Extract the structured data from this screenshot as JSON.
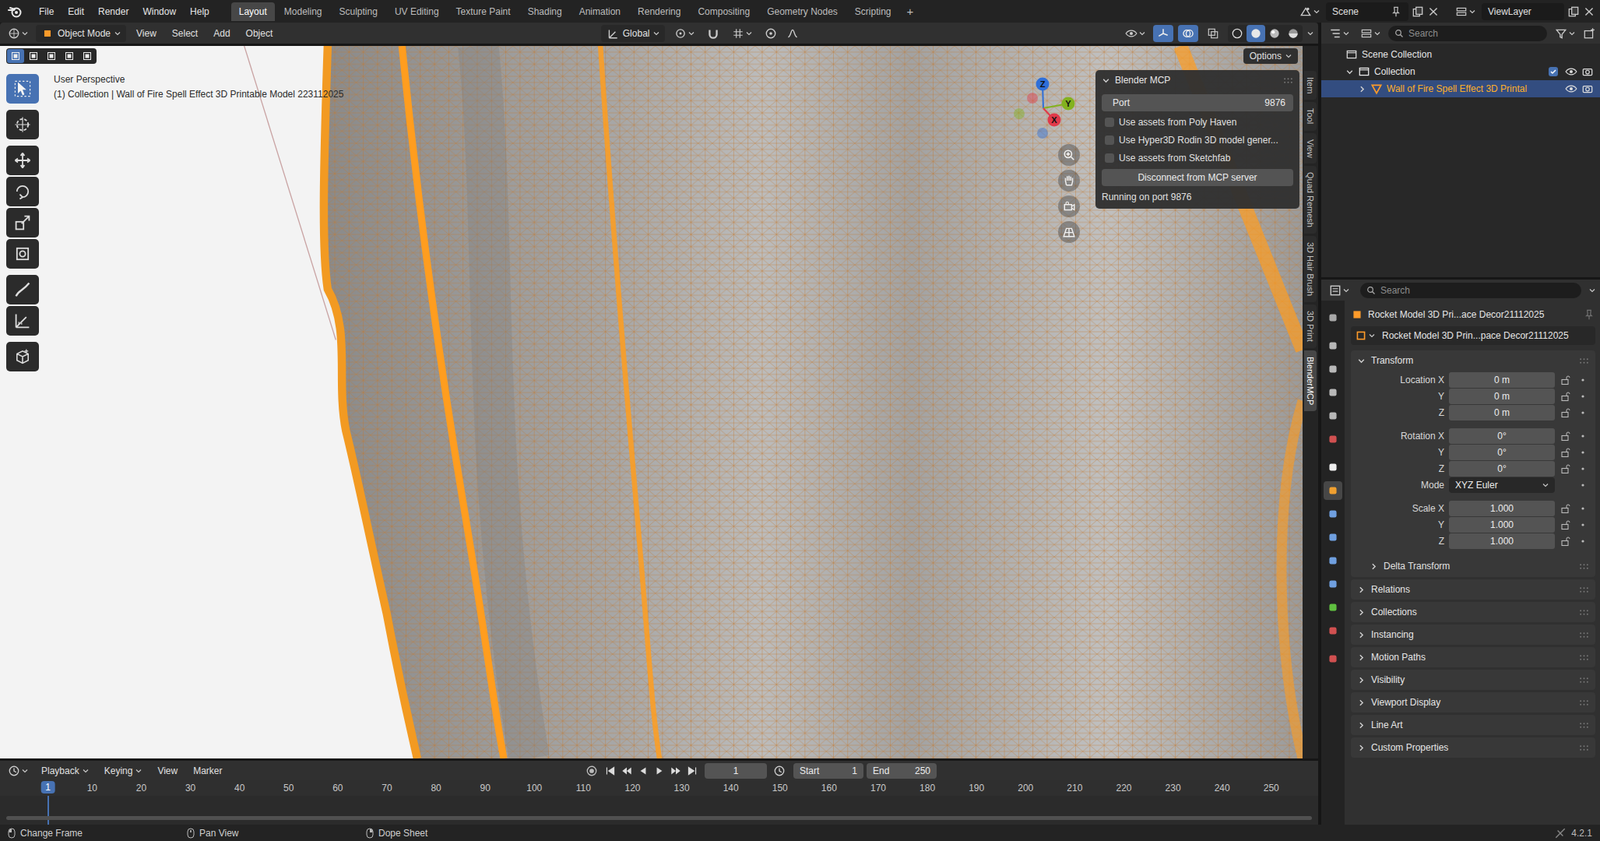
{
  "menu": [
    "File",
    "Edit",
    "Render",
    "Window",
    "Help"
  ],
  "workspaces": [
    {
      "label": "Layout",
      "selected": true
    },
    {
      "label": "Modeling",
      "selected": false
    },
    {
      "label": "Sculpting",
      "selected": false
    },
    {
      "label": "UV Editing",
      "selected": false
    },
    {
      "label": "Texture Paint",
      "selected": false
    },
    {
      "label": "Shading",
      "selected": false
    },
    {
      "label": "Animation",
      "selected": false
    },
    {
      "label": "Rendering",
      "selected": false
    },
    {
      "label": "Compositing",
      "selected": false
    },
    {
      "label": "Geometry Nodes",
      "selected": false
    },
    {
      "label": "Scripting",
      "selected": false
    }
  ],
  "add_workspace": "+",
  "scene": "Scene",
  "view_layer": "ViewLayer",
  "viewport_header": {
    "mode": "Object Mode",
    "menus": [
      "View",
      "Select",
      "Add",
      "Object"
    ],
    "orientation": "Global",
    "overlay_toggles": [
      {
        "selected": true
      },
      {
        "selected": true
      },
      {
        "selected": false
      }
    ],
    "shading_modes": [
      {
        "selected": false
      },
      {
        "selected": true
      },
      {
        "selected": false
      },
      {
        "selected": false
      }
    ]
  },
  "select_modes": [
    {
      "selected": true
    },
    {
      "selected": false
    },
    {
      "selected": false
    },
    {
      "selected": false
    },
    {
      "selected": false
    }
  ],
  "options_button": "Options",
  "viewport": {
    "perspective": "User Perspective",
    "info": "(1) Collection | Wall of Fire Spell Effect 3D Printable Model 223112025",
    "gizmo_axes": [
      {
        "label": "Z",
        "color": "#2f6fd8"
      },
      {
        "label": "Y",
        "color": "#83b21f"
      },
      {
        "label": "X",
        "color": "#e0394a"
      }
    ]
  },
  "tools": [
    {
      "selected": true
    },
    {
      "selected": false
    },
    {
      "selected": false
    },
    {
      "selected": false
    },
    {
      "selected": false
    },
    {
      "selected": false
    },
    {
      "selected": false
    },
    {
      "selected": false
    },
    {
      "selected": false
    }
  ],
  "mcp_panel": {
    "title": "Blender MCP",
    "expanded": true,
    "port_label": "Port",
    "port": "9876",
    "checkboxes": [
      {
        "label": "Use assets from Poly Haven",
        "checked": false
      },
      {
        "label": "Use Hyper3D Rodin 3D model gener...",
        "checked": false
      },
      {
        "label": "Use assets from Sketchfab",
        "checked": false
      }
    ],
    "button": "Disconnect from MCP server",
    "status": "Running on port 9876"
  },
  "side_tabs": [
    {
      "label": "Item",
      "selected": false
    },
    {
      "label": "Tool",
      "selected": false
    },
    {
      "label": "View",
      "selected": false
    },
    {
      "label": "Quad Remesh",
      "selected": false
    },
    {
      "label": "3D Hair Brush",
      "selected": false
    },
    {
      "label": "3D Print",
      "selected": false
    },
    {
      "label": "BlenderMCP",
      "selected": true
    }
  ],
  "outliner": {
    "search_placeholder": "Search",
    "items": [
      {
        "label": "Scene Collection",
        "kind": "scene",
        "selected": false
      },
      {
        "label": "Collection",
        "kind": "collection",
        "expanded": true,
        "selected": false,
        "checked": true,
        "visible": true,
        "renderable": true
      },
      {
        "label": "Wall of Fire Spell Effect 3D Printal",
        "kind": "object",
        "expanded": false,
        "selected": true,
        "visible": true,
        "renderable": true
      }
    ]
  },
  "properties": {
    "search_placeholder": "Search",
    "tabs": [
      {
        "color": "#a8a8a8",
        "selected": false
      },
      {
        "color": "#b8b8b8",
        "selected": false
      },
      {
        "color": "#b8b8b8",
        "selected": false
      },
      {
        "color": "#b8b8b8",
        "selected": false
      },
      {
        "color": "#b8b8b8",
        "selected": false
      },
      {
        "color": "#d05050",
        "selected": false
      },
      {
        "color": "#eeeeee",
        "selected": false
      },
      {
        "color": "#f0a030",
        "selected": true
      },
      {
        "color": "#6f9fdf",
        "selected": false
      },
      {
        "color": "#6f9fdf",
        "selected": false
      },
      {
        "color": "#6f9fdf",
        "selected": false
      },
      {
        "color": "#6f9fdf",
        "selected": false
      },
      {
        "color": "#60c040",
        "selected": false
      },
      {
        "color": "#d05050",
        "selected": false
      },
      {
        "color": "#d05050",
        "selected": false
      }
    ],
    "object_name": "Rocket Model 3D Pri...ace Decor21112025",
    "pinned": false,
    "data_name": "Rocket Model 3D Prin...pace Decor21112025",
    "transform": {
      "label": "Transform",
      "expanded": true,
      "groups": [
        {
          "rows": [
            {
              "label": "Location X",
              "value": "0 m",
              "kind": "number",
              "locked": false
            },
            {
              "label": "Y",
              "value": "0 m",
              "kind": "number",
              "locked": false
            },
            {
              "label": "Z",
              "value": "0 m",
              "kind": "number",
              "locked": false
            }
          ]
        },
        {
          "rows": [
            {
              "label": "Rotation X",
              "value": "0°",
              "kind": "number",
              "locked": false
            },
            {
              "label": "Y",
              "value": "0°",
              "kind": "number",
              "locked": false
            },
            {
              "label": "Z",
              "value": "0°",
              "kind": "number",
              "locked": false
            },
            {
              "label": "Mode",
              "value": "XYZ Euler",
              "kind": "dropdown",
              "locked": false
            }
          ]
        },
        {
          "rows": [
            {
              "label": "Scale X",
              "value": "1.000",
              "kind": "number",
              "locked": false
            },
            {
              "label": "Y",
              "value": "1.000",
              "kind": "number",
              "locked": false
            },
            {
              "label": "Z",
              "value": "1.000",
              "kind": "number",
              "locked": false
            }
          ]
        }
      ]
    },
    "subpanels": [
      {
        "label": "Delta Transform",
        "expanded": false
      }
    ],
    "panels": [
      {
        "label": "Relations",
        "expanded": false
      },
      {
        "label": "Collections",
        "expanded": false
      },
      {
        "label": "Instancing",
        "expanded": false
      },
      {
        "label": "Motion Paths",
        "expanded": false
      },
      {
        "label": "Visibility",
        "expanded": false
      },
      {
        "label": "Viewport Display",
        "expanded": false
      },
      {
        "label": "Line Art",
        "expanded": false
      },
      {
        "label": "Custom Properties",
        "expanded": false
      }
    ]
  },
  "timeline": {
    "menus": [
      {
        "label": "Playback",
        "dropdown": true
      },
      {
        "label": "Keying",
        "dropdown": true
      },
      {
        "label": "View",
        "dropdown": false
      },
      {
        "label": "Marker",
        "dropdown": false
      }
    ],
    "current_frame": "1",
    "start_label": "Start",
    "start": "1",
    "end_label": "End",
    "end": "250",
    "playhead": "1",
    "ruler": [
      "10",
      "20",
      "30",
      "40",
      "50",
      "60",
      "70",
      "80",
      "90",
      "100",
      "110",
      "120",
      "130",
      "140",
      "150",
      "160",
      "170",
      "180",
      "190",
      "200",
      "210",
      "220",
      "230",
      "240",
      "250"
    ]
  },
  "status_bar": {
    "hints": [
      "Change Frame",
      "Pan View",
      "Dope Sheet"
    ],
    "version": "4.2.1"
  }
}
